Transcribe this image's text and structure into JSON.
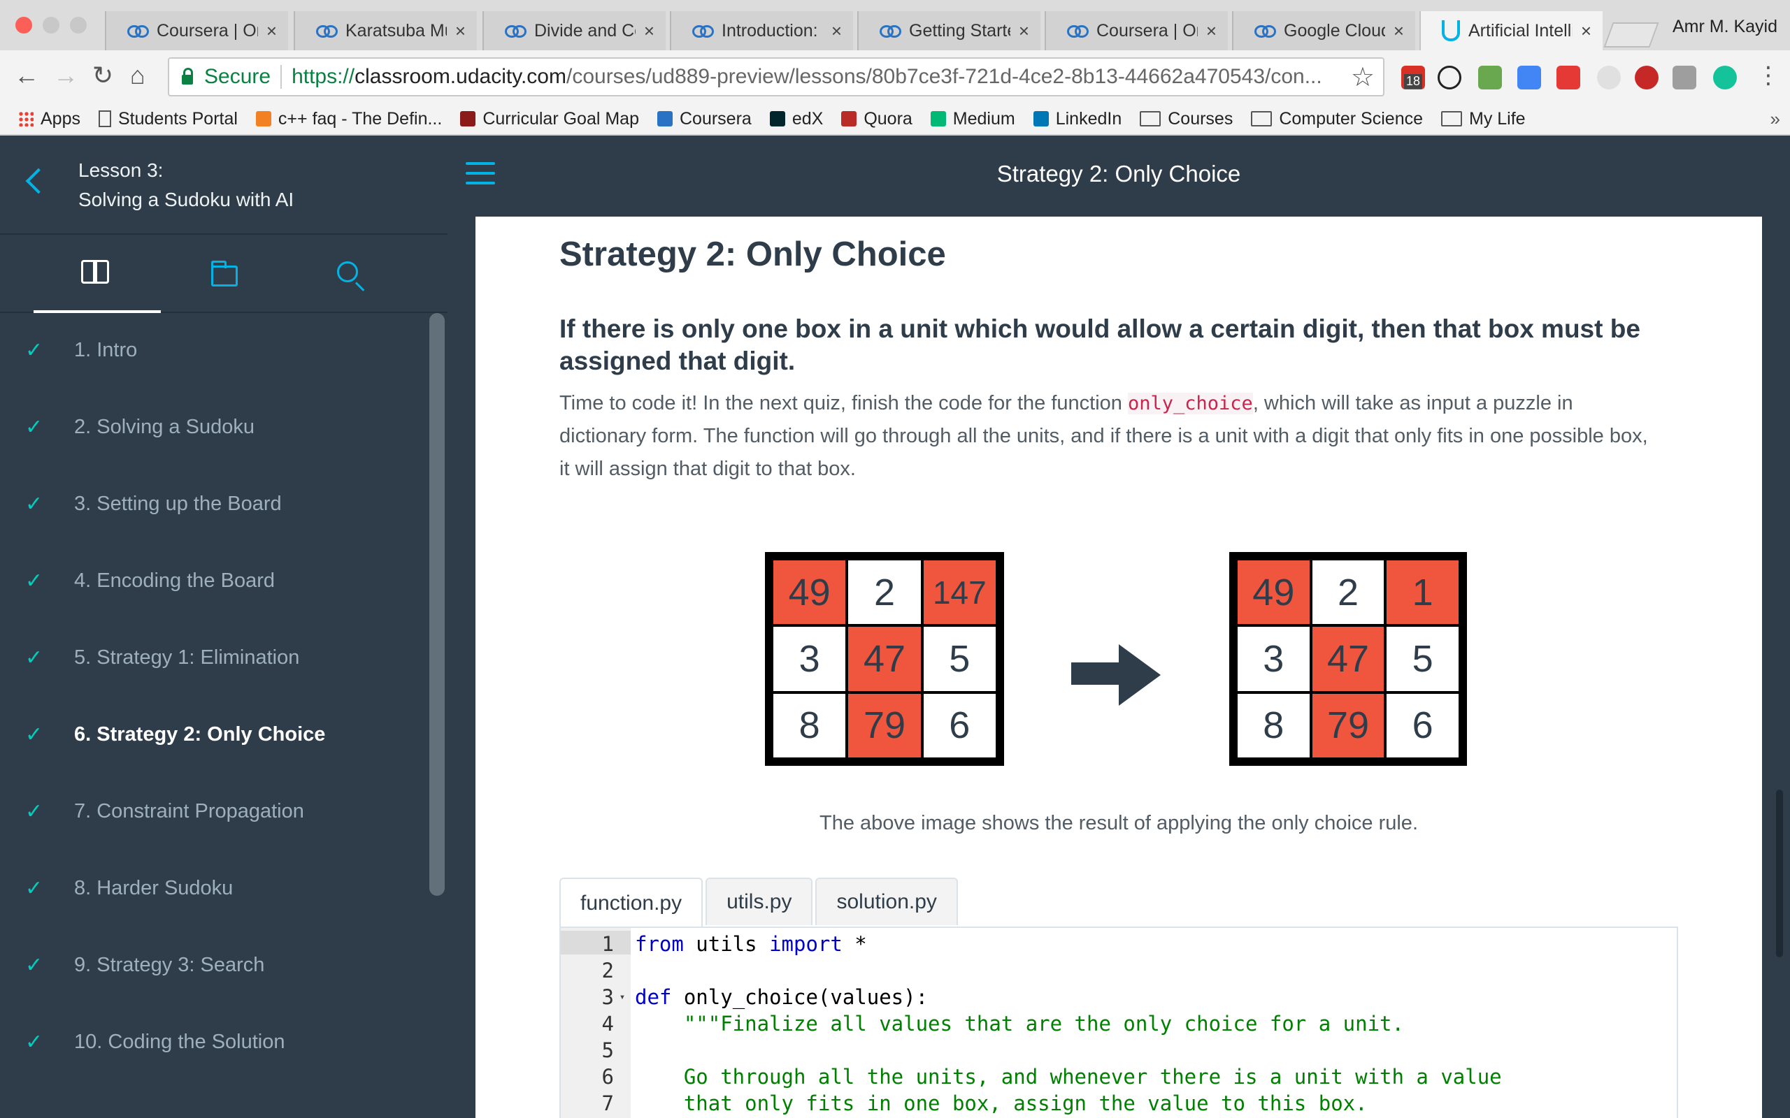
{
  "browser": {
    "tabs": [
      {
        "title": "Coursera | On",
        "icon": "coursera-icon"
      },
      {
        "title": "Karatsuba Mu",
        "icon": "coursera-icon"
      },
      {
        "title": "Divide and Co",
        "icon": "coursera-icon"
      },
      {
        "title": "Introduction: N",
        "icon": "coursera-icon"
      },
      {
        "title": "Getting Starte",
        "icon": "coursera-icon"
      },
      {
        "title": "Coursera | On",
        "icon": "coursera-icon"
      },
      {
        "title": "Google Cloud",
        "icon": "coursera-icon"
      },
      {
        "title": "Artificial Intelli",
        "icon": "udacity-icon",
        "active": true
      }
    ],
    "profile_name": "Amr M. Kayid",
    "secure_label": "Secure",
    "url_scheme": "https://",
    "url_host": "classroom.udacity.com",
    "url_path": "/courses/ud889-preview/lessons/80b7ce3f-721d-4ce2-8b13-44662a470543/con...",
    "extension_badge": "18",
    "bookmarks": [
      {
        "label": "Apps",
        "icon": "apps-icon"
      },
      {
        "label": "Students Portal",
        "icon": "doc-icon"
      },
      {
        "label": "c++ faq - The Defin...",
        "icon": "stackoverflow-icon"
      },
      {
        "label": "Curricular Goal Map",
        "icon": "bars-icon"
      },
      {
        "label": "Coursera",
        "icon": "coursera-icon"
      },
      {
        "label": "edX",
        "icon": "edx-icon"
      },
      {
        "label": "Quora",
        "icon": "quora-icon"
      },
      {
        "label": "Medium",
        "icon": "medium-icon"
      },
      {
        "label": "LinkedIn",
        "icon": "linkedin-icon"
      },
      {
        "label": "Courses",
        "icon": "folder-icon"
      },
      {
        "label": "Computer Science",
        "icon": "folder-icon"
      },
      {
        "label": "My Life",
        "icon": "folder-icon"
      }
    ],
    "bookmarks_more": "»"
  },
  "sidebar": {
    "lesson_number": "Lesson 3:",
    "lesson_title": "Solving a Sudoku with AI",
    "concepts": [
      {
        "label": "1. Intro",
        "done": true
      },
      {
        "label": "2. Solving a Sudoku",
        "done": true
      },
      {
        "label": "3. Setting up the Board",
        "done": true
      },
      {
        "label": "4. Encoding the Board",
        "done": true
      },
      {
        "label": "5. Strategy 1: Elimination",
        "done": true
      },
      {
        "label": "6. Strategy 2: Only Choice",
        "done": true,
        "current": true
      },
      {
        "label": "7. Constraint Propagation",
        "done": true
      },
      {
        "label": "8. Harder Sudoku",
        "done": true
      },
      {
        "label": "9. Strategy 3: Search",
        "done": true
      },
      {
        "label": "10. Coding the Solution",
        "done": true
      }
    ]
  },
  "header": {
    "title": "Strategy 2: Only Choice"
  },
  "content": {
    "title": "Strategy 2: Only Choice",
    "subtitle": "If there is only one box in a unit which would allow a certain digit, then that box must be assigned that digit.",
    "para_before": "Time to code it! In the next quiz, finish the code for the function ",
    "para_code": "only_choice",
    "para_after": ", which will take as input a puzzle in dictionary form. The function will go through all the units, and if there is a unit with a digit that only fits in one possible box, it will assign that digit to that box.",
    "grid_before": [
      {
        "v": "49",
        "hot": true
      },
      {
        "v": "2",
        "hot": false
      },
      {
        "v": "147",
        "hot": true
      },
      {
        "v": "3",
        "hot": false
      },
      {
        "v": "47",
        "hot": true
      },
      {
        "v": "5",
        "hot": false
      },
      {
        "v": "8",
        "hot": false
      },
      {
        "v": "79",
        "hot": true
      },
      {
        "v": "6",
        "hot": false
      }
    ],
    "grid_after": [
      {
        "v": "49",
        "hot": true
      },
      {
        "v": "2",
        "hot": false
      },
      {
        "v": "1",
        "hot": true
      },
      {
        "v": "3",
        "hot": false
      },
      {
        "v": "47",
        "hot": true
      },
      {
        "v": "5",
        "hot": false
      },
      {
        "v": "8",
        "hot": false
      },
      {
        "v": "79",
        "hot": true
      },
      {
        "v": "6",
        "hot": false
      }
    ],
    "caption": "The above image shows the result of applying the only choice rule."
  },
  "editor": {
    "file_tabs": [
      {
        "label": "function.py",
        "active": true
      },
      {
        "label": "utils.py",
        "active": false
      },
      {
        "label": "solution.py",
        "active": false
      }
    ],
    "lines": [
      {
        "n": "1",
        "code": "from utils import *",
        "fold": false
      },
      {
        "n": "2",
        "code": "",
        "fold": false
      },
      {
        "n": "3",
        "code": "def only_choice(values):",
        "fold": true
      },
      {
        "n": "4",
        "code": "    \"\"\"Finalize all values that are the only choice for a unit.",
        "fold": false
      },
      {
        "n": "5",
        "code": "",
        "fold": false
      },
      {
        "n": "6",
        "code": "    Go through all the units, and whenever there is a unit with a value",
        "fold": false
      },
      {
        "n": "7",
        "code": "    that only fits in one box, assign the value to this box.",
        "fold": false
      }
    ]
  },
  "colors": {
    "sidebar_bg": "#2e3d49",
    "accent": "#02b3e4",
    "check": "#02ccba",
    "sudoku_highlight": "#f0553d"
  }
}
